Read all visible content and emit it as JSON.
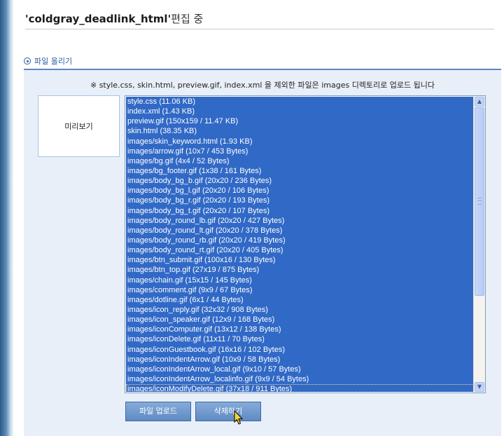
{
  "header": {
    "title_name": "'coldgray_deadlink_html'",
    "title_suffix": "편집 중"
  },
  "upload_section": {
    "label": "파일 올리기",
    "notice": "※ style.css, skin.html, preview.gif, index.xml 을 제외한 파일은 images 디렉토리로 업로드 됩니다",
    "preview_label": "미리보기",
    "files": [
      "style.css (11.06 KB)",
      "index.xml (1.43 KB)",
      "preview.gif (150x159 / 11.47 KB)",
      "skin.html (38.35 KB)",
      "images/skin_keyword.html (1.93 KB)",
      "images/arrow.gif (10x7 / 453 Bytes)",
      "images/bg.gif (4x4 / 52 Bytes)",
      "images/bg_footer.gif (1x38 / 161 Bytes)",
      "images/body_bg_b.gif (20x20 / 236 Bytes)",
      "images/body_bg_l.gif (20x20 / 106 Bytes)",
      "images/body_bg_r.gif (20x20 / 193 Bytes)",
      "images/body_bg_t.gif (20x20 / 107 Bytes)",
      "images/body_round_lb.gif (20x20 / 427 Bytes)",
      "images/body_round_lt.gif (20x20 / 378 Bytes)",
      "images/body_round_rb.gif (20x20 / 419 Bytes)",
      "images/body_round_rt.gif (20x20 / 405 Bytes)",
      "images/btn_submit.gif (100x16 / 130 Bytes)",
      "images/btn_top.gif (27x19 / 875 Bytes)",
      "images/chain.gif (15x15 / 145 Bytes)",
      "images/comment.gif (9x9 / 67 Bytes)",
      "images/dotline.gif (6x1 / 44 Bytes)",
      "images/icon_reply.gif (32x32 / 908 Bytes)",
      "images/icon_speaker.gif (12x9 / 168 Bytes)",
      "images/iconComputer.gif (13x12 / 138 Bytes)",
      "images/iconDelete.gif (11x11 / 70 Bytes)",
      "images/iconGuestbook.gif (16x16 / 102 Bytes)",
      "images/iconIndentArrow.gif (10x9 / 58 Bytes)",
      "images/iconIndentArrow_local.gif (9x10 / 57 Bytes)",
      "images/iconIndentArrow_localinfo.gif (9x9 / 54 Bytes)",
      "images/iconModifyDelete.gif (37x18 / 911 Bytes)"
    ],
    "selected": "all",
    "buttons": {
      "upload": "파일 업로드",
      "delete": "삭제하기"
    }
  },
  "colors": {
    "accent": "#2b5ba2",
    "selection": "#3169c6",
    "panel_bg": "#e9eff8",
    "button": "#6f97cc"
  },
  "icons": {
    "section": "circle-bullet-icon",
    "scroll_up": "arrow-up-icon",
    "scroll_down": "arrow-down-icon",
    "cursor": "hand-pointer-icon"
  }
}
